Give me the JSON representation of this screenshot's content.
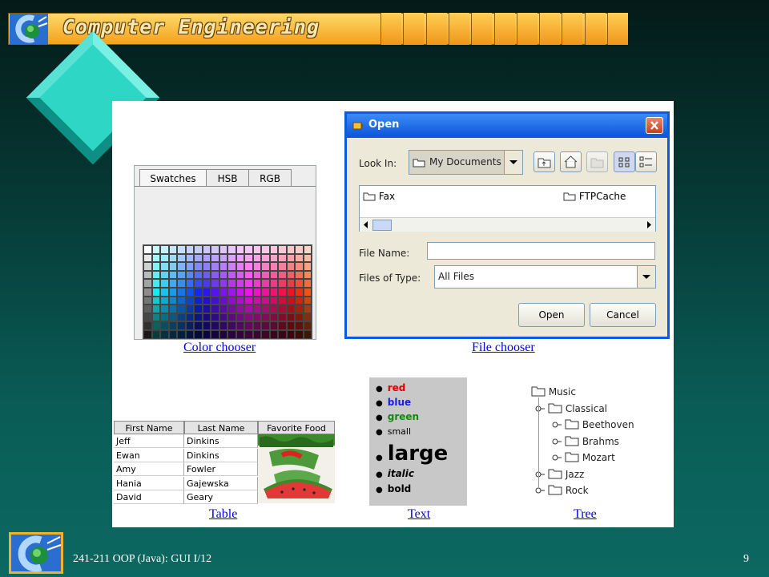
{
  "header": {
    "title": "Computer Engineering"
  },
  "colors": {
    "banner_top": "#ffd86a",
    "banner_bottom": "#f3a21a",
    "diamond": "#2ed6c6",
    "link": "#0000ee",
    "xp_blue": "#0a5be0"
  },
  "color_chooser": {
    "tabs": [
      "Swatches",
      "HSB",
      "RGB"
    ],
    "caption": "Color chooser"
  },
  "file_chooser": {
    "title": "Open",
    "look_in_label": "Look In:",
    "look_in_value": "My Documents",
    "files": [
      "Fax",
      "FTPCache"
    ],
    "file_name_label": "File Name:",
    "file_name_value": "",
    "files_of_type_label": "Files of Type:",
    "files_of_type_value": "All Files",
    "open_button": "Open",
    "cancel_button": "Cancel",
    "caption": "File chooser",
    "icons": [
      "up-folder-icon",
      "home-icon",
      "new-folder-icon",
      "list-view-icon",
      "details-view-icon"
    ]
  },
  "table": {
    "headers": [
      "First Name",
      "Last Name",
      "Favorite Food"
    ],
    "rows": [
      [
        "Jeff",
        "Dinkins"
      ],
      [
        "Ewan",
        "Dinkins"
      ],
      [
        "Amy",
        "Fowler"
      ],
      [
        "Hania",
        "Gajewska"
      ],
      [
        "David",
        "Geary"
      ]
    ],
    "caption": "Table"
  },
  "text_sample": {
    "items": [
      {
        "text": "red",
        "color": "#dd0000"
      },
      {
        "text": "blue",
        "color": "#1a1aee"
      },
      {
        "text": "green",
        "color": "#118811"
      },
      {
        "text": "small",
        "color": "#000000"
      },
      {
        "text": "large",
        "color": "#000000"
      },
      {
        "text": "italic",
        "color": "#000000"
      },
      {
        "text": "bold",
        "color": "#000000"
      }
    ],
    "caption": "Text"
  },
  "tree": {
    "nodes": [
      {
        "label": "Music",
        "depth": 0
      },
      {
        "label": "Classical",
        "depth": 1
      },
      {
        "label": "Beethoven",
        "depth": 2
      },
      {
        "label": "Brahms",
        "depth": 2
      },
      {
        "label": "Mozart",
        "depth": 2
      },
      {
        "label": "Jazz",
        "depth": 1
      },
      {
        "label": "Rock",
        "depth": 1
      }
    ],
    "caption": "Tree"
  },
  "footer": {
    "course": "241-211 OOP (Java): GUI I/12",
    "slide_number": "9"
  }
}
